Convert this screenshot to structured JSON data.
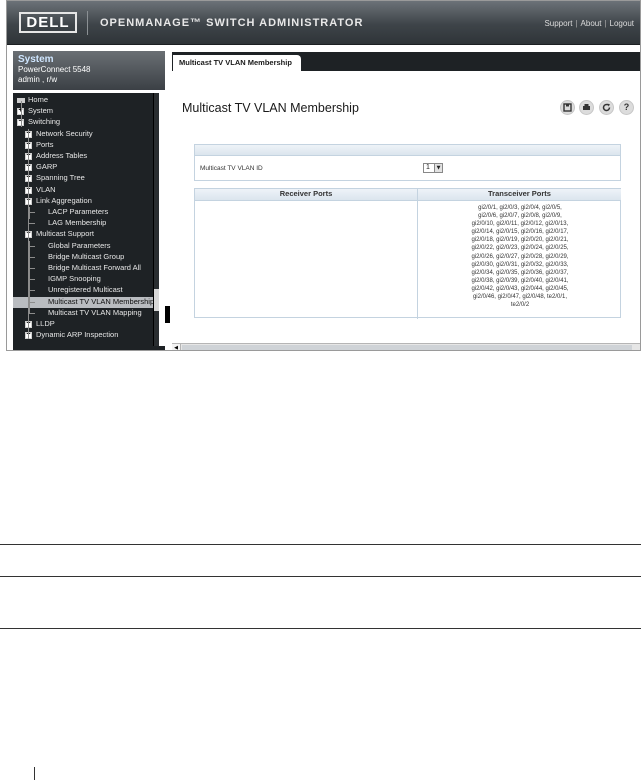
{
  "header": {
    "logo_text": "DELL",
    "app_title": "OPENMANAGE™ SWITCH ADMINISTRATOR",
    "links": [
      "Support",
      "About",
      "Logout"
    ]
  },
  "system_box": {
    "title": "System",
    "device": "PowerConnect 5548",
    "user": "admin , r/w"
  },
  "tree": [
    {
      "label": "Home",
      "level": 0,
      "toggle": "home"
    },
    {
      "label": "System",
      "level": 0,
      "toggle": "+"
    },
    {
      "label": "Switching",
      "level": 0,
      "toggle": "-"
    },
    {
      "label": "Network Security",
      "level": 1,
      "toggle": "+"
    },
    {
      "label": "Ports",
      "level": 1,
      "toggle": "+"
    },
    {
      "label": "Address Tables",
      "level": 1,
      "toggle": "+"
    },
    {
      "label": "GARP",
      "level": 1,
      "toggle": "+"
    },
    {
      "label": "Spanning Tree",
      "level": 1,
      "toggle": "+"
    },
    {
      "label": "VLAN",
      "level": 1,
      "toggle": "+"
    },
    {
      "label": "Link Aggregation",
      "level": 1,
      "toggle": "-"
    },
    {
      "label": "LACP Parameters",
      "level": 2,
      "toggle": ""
    },
    {
      "label": "LAG Membership",
      "level": 2,
      "toggle": ""
    },
    {
      "label": "Multicast Support",
      "level": 1,
      "toggle": "-"
    },
    {
      "label": "Global Parameters",
      "level": 2,
      "toggle": ""
    },
    {
      "label": "Bridge Multicast Group",
      "level": 2,
      "toggle": ""
    },
    {
      "label": "Bridge Multicast Forward All",
      "level": 2,
      "toggle": ""
    },
    {
      "label": "IGMP Snooping",
      "level": 2,
      "toggle": ""
    },
    {
      "label": "Unregistered Multicast",
      "level": 2,
      "toggle": ""
    },
    {
      "label": "Multicast TV VLAN Membership",
      "level": 2,
      "toggle": "",
      "selected": true
    },
    {
      "label": "Multicast TV VLAN Mapping",
      "level": 2,
      "toggle": ""
    },
    {
      "label": "LLDP",
      "level": 1,
      "toggle": "+"
    },
    {
      "label": "Dynamic ARP Inspection",
      "level": 1,
      "toggle": "+"
    }
  ],
  "tab": {
    "label": "Multicast TV VLAN Membership"
  },
  "page": {
    "title": "Multicast TV VLAN Membership",
    "toolbar_icons": [
      "save-icon",
      "print-icon",
      "refresh-icon",
      "help-icon"
    ]
  },
  "form": {
    "vlan_label": "Multicast TV VLAN ID",
    "vlan_value": "1"
  },
  "table": {
    "headers": [
      "Receiver Ports",
      "Transceiver Ports"
    ],
    "transceiver_lines": [
      "gi2/0/1, gi2/0/3, gi2/0/4, gi2/0/5,",
      "gi2/0/6, gi2/0/7, gi2/0/8, gi2/0/9,",
      "gi2/0/10, gi2/0/11, gi2/0/12, gi2/0/13,",
      "gi2/0/14, gi2/0/15, gi2/0/16, gi2/0/17,",
      "gi2/0/18, gi2/0/19, gi2/0/20, gi2/0/21,",
      "gi2/0/22, gi2/0/23, gi2/0/24, gi2/0/25,",
      "gi2/0/26, gi2/0/27, gi2/0/28, gi2/0/29,",
      "gi2/0/30, gi2/0/31, gi2/0/32, gi2/0/33,",
      "gi2/0/34, gi2/0/35, gi2/0/36, gi2/0/37,",
      "gi2/0/38, gi2/0/39, gi2/0/40, gi2/0/41,",
      "gi2/0/42, gi2/0/43, gi2/0/44, gi2/0/45,",
      "gi2/0/46, gi2/0/47, gi2/0/48, te2/0/1,",
      "te2/0/2"
    ]
  }
}
